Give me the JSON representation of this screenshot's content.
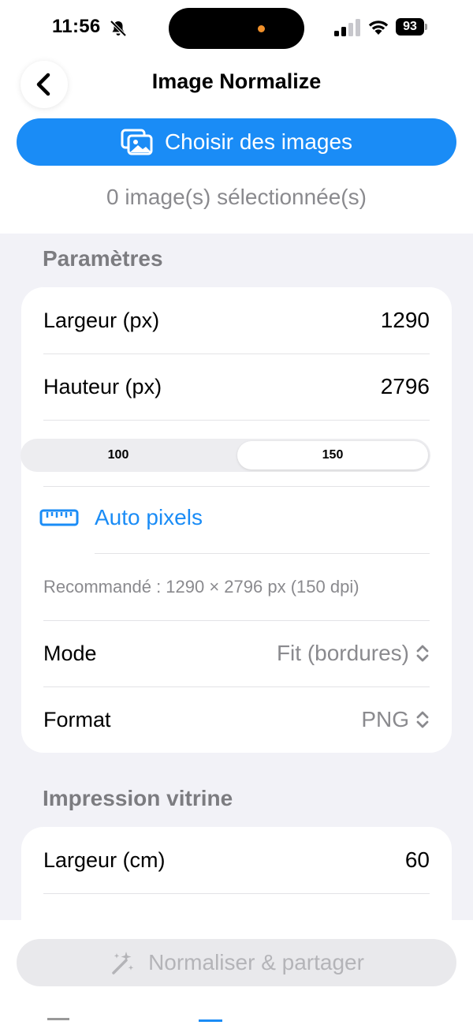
{
  "status_bar": {
    "time": "11:56",
    "battery": "93"
  },
  "nav": {
    "title": "Image Normalize"
  },
  "choose": {
    "label": "Choisir des images"
  },
  "selection": {
    "count_text": "0 image(s) sélectionnée(s)"
  },
  "params": {
    "header": "Paramètres",
    "width_label": "Largeur (px)",
    "width_value": "1290",
    "height_label": "Hauteur (px)",
    "height_value": "2796",
    "dpi_options": [
      "100",
      "150"
    ],
    "dpi_selected": "150",
    "auto_label": "Auto pixels",
    "recommended": "Recommandé : 1290 × 2796 px (150 dpi)",
    "mode_label": "Mode",
    "mode_value": "Fit (bordures)",
    "format_label": "Format",
    "format_value": "PNG"
  },
  "print": {
    "header": "Impression vitrine",
    "width_label": "Largeur (cm)",
    "width_value": "60"
  },
  "action": {
    "label": "Normaliser & partager"
  },
  "colors": {
    "accent": "#1a8cf6",
    "background": "#f2f2f7",
    "disabled_text": "#b4b4b8"
  }
}
